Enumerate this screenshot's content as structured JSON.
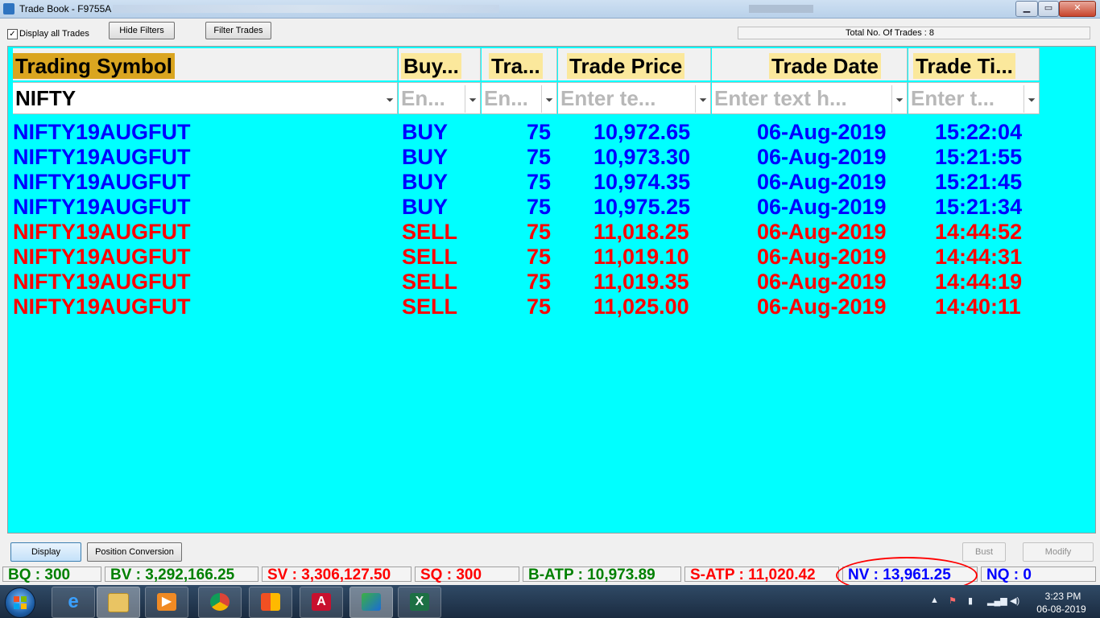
{
  "window": {
    "title": "Trade Book - F9755A",
    "min": "▁",
    "max": "▭",
    "close": "✕"
  },
  "toolbar": {
    "display_all_label": "Display all Trades",
    "display_all_checked": true,
    "checkmark": "✓",
    "hide_filters": "Hide Filters",
    "filter_trades": "Filter Trades",
    "total_trades": "Total No. Of Trades : 8"
  },
  "grid": {
    "background": "#00ffff",
    "header_highlight": "#fbe89c",
    "columns": [
      "Trading Symbol",
      "Buy...",
      "Tra...",
      "Trade Price",
      "Trade Date",
      "Trade Ti..."
    ],
    "filters": [
      "NIFTY",
      "En...",
      "En...",
      "Enter te...",
      "Enter text h...",
      "Enter t..."
    ],
    "filter_icon": "⏷",
    "rows": [
      {
        "symbol": "NIFTY19AUGFUT",
        "side": "BUY",
        "qty": "75",
        "price": "10,972.65",
        "date": "06-Aug-2019",
        "time": "15:22:04"
      },
      {
        "symbol": "NIFTY19AUGFUT",
        "side": "BUY",
        "qty": "75",
        "price": "10,973.30",
        "date": "06-Aug-2019",
        "time": "15:21:55"
      },
      {
        "symbol": "NIFTY19AUGFUT",
        "side": "BUY",
        "qty": "75",
        "price": "10,974.35",
        "date": "06-Aug-2019",
        "time": "15:21:45"
      },
      {
        "symbol": "NIFTY19AUGFUT",
        "side": "BUY",
        "qty": "75",
        "price": "10,975.25",
        "date": "06-Aug-2019",
        "time": "15:21:34"
      },
      {
        "symbol": "NIFTY19AUGFUT",
        "side": "SELL",
        "qty": "75",
        "price": "11,018.25",
        "date": "06-Aug-2019",
        "time": "14:44:52"
      },
      {
        "symbol": "NIFTY19AUGFUT",
        "side": "SELL",
        "qty": "75",
        "price": "11,019.10",
        "date": "06-Aug-2019",
        "time": "14:44:31"
      },
      {
        "symbol": "NIFTY19AUGFUT",
        "side": "SELL",
        "qty": "75",
        "price": "11,019.35",
        "date": "06-Aug-2019",
        "time": "14:44:19"
      },
      {
        "symbol": "NIFTY19AUGFUT",
        "side": "SELL",
        "qty": "75",
        "price": "11,025.00",
        "date": "06-Aug-2019",
        "time": "14:40:11"
      }
    ]
  },
  "bottom": {
    "display": "Display",
    "position_conversion": "Position Conversion",
    "bust": "Bust",
    "modify": "Modify"
  },
  "status": {
    "bq": "BQ : 300",
    "bv": "BV : 3,292,166.25",
    "sv": "SV : 3,306,127.50",
    "sq": "SQ : 300",
    "batp": "B-ATP : 10,973.89",
    "satp": "S-ATP : 11,020.42",
    "nv": "NV : 13,961.25",
    "nq": "NQ : 0"
  },
  "taskbar": {
    "time": "3:23 PM",
    "date": "06-08-2019",
    "apps": [
      "ie-icon",
      "explorer-icon",
      "media-player-icon",
      "chrome-icon",
      "office-icon",
      "acrobat-icon",
      "trading-app-icon",
      "excel-icon"
    ],
    "app_glyphs": [
      "e",
      "",
      "▶",
      "",
      "",
      "A",
      "",
      "X"
    ]
  }
}
